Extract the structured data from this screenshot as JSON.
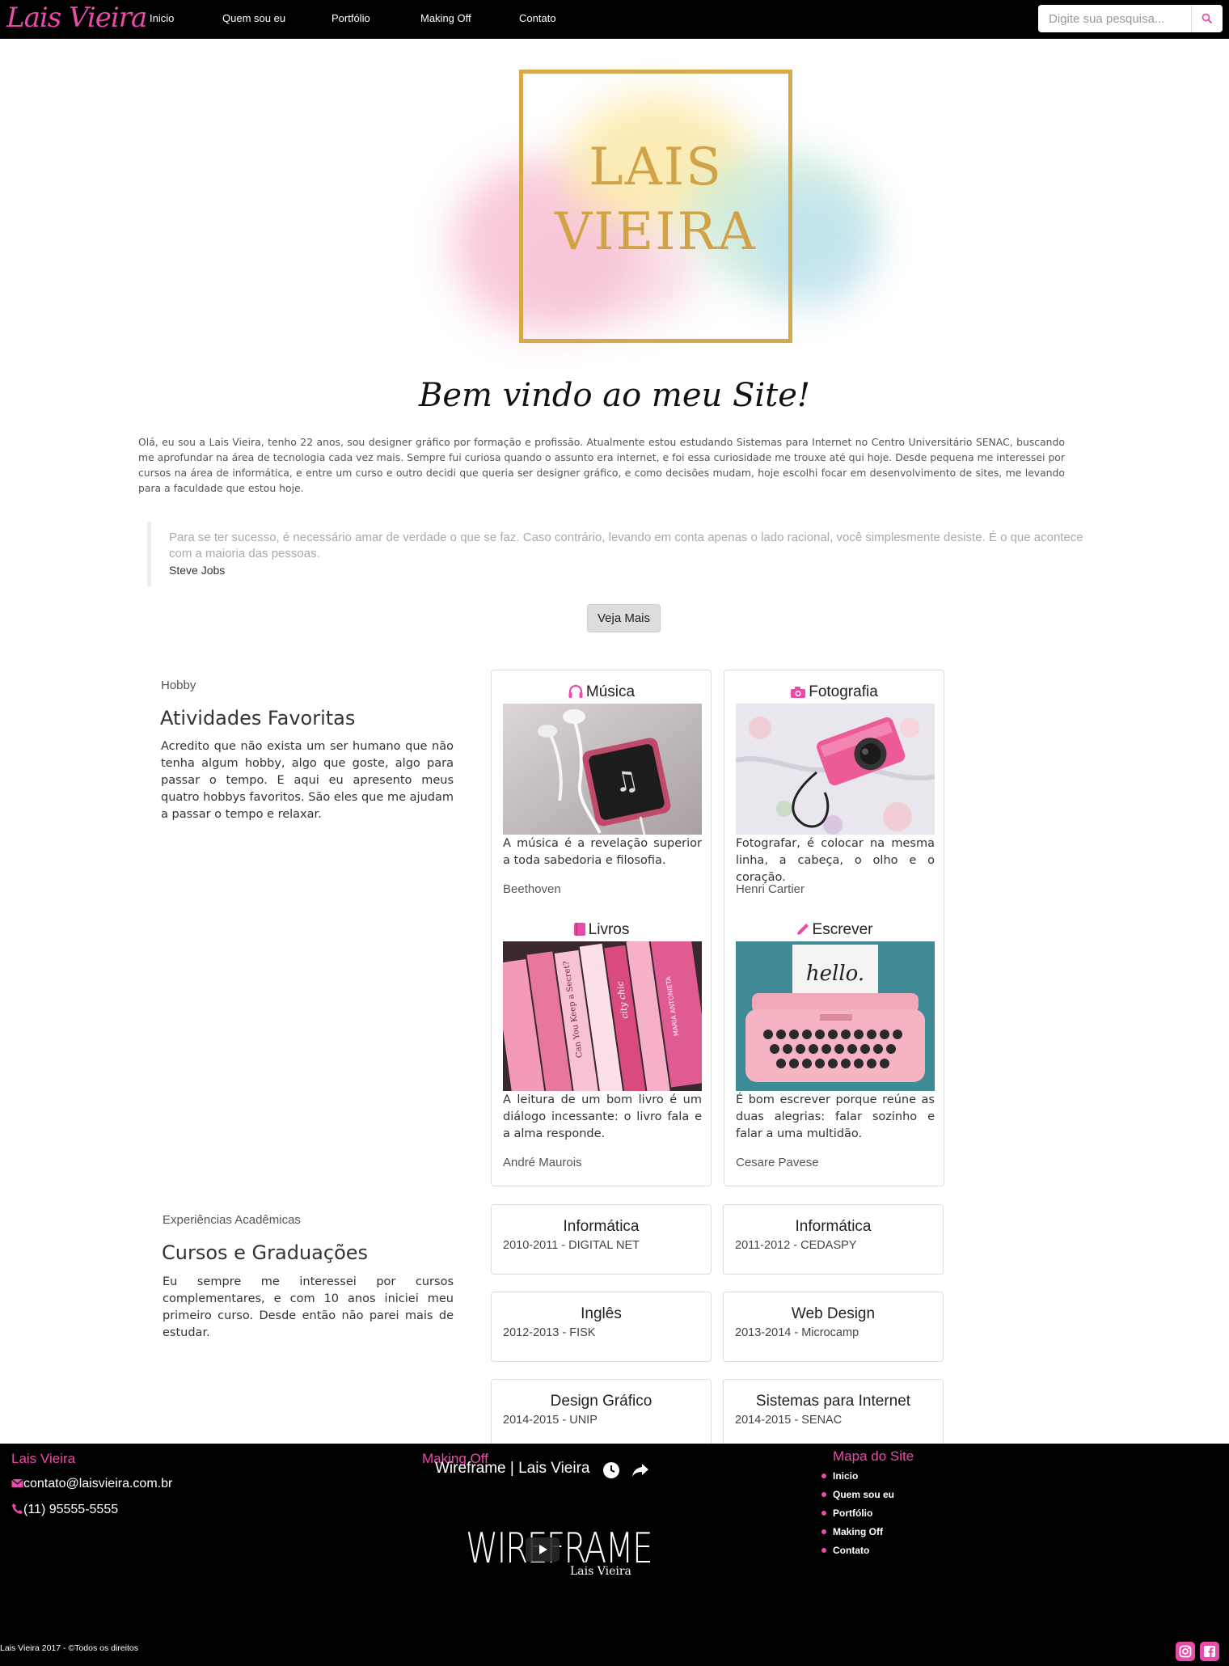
{
  "nav": {
    "brand": "Lais Vieira",
    "links": [
      "Inicio",
      "Quem sou eu",
      "Portfólio",
      "Making Off",
      "Contato"
    ],
    "search_placeholder": "Digite sua pesquisa...",
    "search_icon": "search-icon"
  },
  "logo": {
    "line1": "LAIS",
    "line2": "VIEIRA"
  },
  "welcome": {
    "title": "Bem vindo ao meu Site!",
    "text": "Olá, eu sou a Lais Vieira, tenho 22 anos, sou designer gráfico por formação e profissão. Atualmente estou estudando Sistemas para Internet no Centro Universitário SENAC, buscando me aprofundar na área de tecnologia cada vez mais. Sempre fui curiosa quando o assunto era internet, e foi essa curiosidade me trouxe até qui hoje. Desde pequena me interessei por cursos na área de informática, e entre um curso e outro decidi que queria ser designer gráfico, e como decisões mudam, hoje escolhi focar em desenvolvimento de sites, me levando para a faculdade que estou hoje."
  },
  "quote": {
    "text": "Para se ter sucesso, é necessário amar de verdade o que se faz. Caso contrário, levando em conta apenas o lado racional, você simplesmente desiste. É o que acontece com a maioria das pessoas.",
    "author": "Steve Jobs"
  },
  "veja_mais": "Veja Mais",
  "hobby": {
    "label": "Hobby",
    "title": "Atividades Favoritas",
    "text": "Acredito que não exista um ser humano que não tenha algum hobby, algo que goste, algo para passar o tempo. E aqui eu apresento meus quatro hobbys favoritos. São eles que me ajudam a passar o tempo e relaxar.",
    "cards": [
      {
        "title": "Música",
        "icon": "headphones-icon",
        "text": "A música é a revelação superior a toda sabedoria e filosofia.",
        "author": "Beethoven"
      },
      {
        "title": "Fotografia",
        "icon": "camera-icon",
        "text": "Fotografar, é colocar na mesma linha, a cabeça, o olho e o coração.",
        "author": "Henri Cartier"
      },
      {
        "title": "Livros",
        "icon": "book-icon",
        "text": "A leitura de um bom livro é um diálogo incessante: o livro fala e a alma responde.",
        "author": "André Maurois"
      },
      {
        "title": "Escrever",
        "icon": "pencil-icon",
        "text": "É bom escrever porque reúne as duas alegrias: falar sozinho e falar a uma multidão.",
        "author": "Cesare Pavese"
      }
    ],
    "book_spines": [
      "MARIA ANTONIETA",
      "city chic",
      "Can You Keep a Secret?"
    ],
    "typewriter_note": "hello."
  },
  "academic": {
    "label": "Experiências Acadêmicas",
    "title": "Cursos e Graduações",
    "text": "Eu sempre me interessei por cursos complementares, e com 10 anos iniciei meu primeiro curso. Desde então não parei mais de estudar.",
    "courses": [
      {
        "title": "Informática",
        "sub": "2010-2011 - DIGITAL NET"
      },
      {
        "title": "Informática",
        "sub": "2011-2012 - CEDASPY"
      },
      {
        "title": "Inglês",
        "sub": "2012-2013 - FISK"
      },
      {
        "title": "Web Design",
        "sub": "2013-2014 - Microcamp"
      },
      {
        "title": "Design Gráfico",
        "sub": "2014-2015 - UNIP"
      },
      {
        "title": "Sistemas para Internet",
        "sub": "2014-2015 - SENAC"
      }
    ]
  },
  "footer": {
    "contact_title": "Lais Vieira",
    "email": "contato@laisvieira.com.br",
    "phone": "(11) 95555-5555",
    "making_off_title": "Making Off",
    "video_title": "Wireframe | Lais Vieira",
    "video_word": "WIREFRAME",
    "video_sub": "Lais Vieira",
    "map_title": "Mapa do Site",
    "map_items": [
      "Inicio",
      "Quem sou eu",
      "Portfólio",
      "Making Off",
      "Contato"
    ],
    "copyright": "Lais Vieira 2017 - ©Todos os direitos"
  },
  "colors": {
    "accent": "#e94ba9",
    "gold": "#d2a346",
    "nav_bg": "#000000"
  }
}
